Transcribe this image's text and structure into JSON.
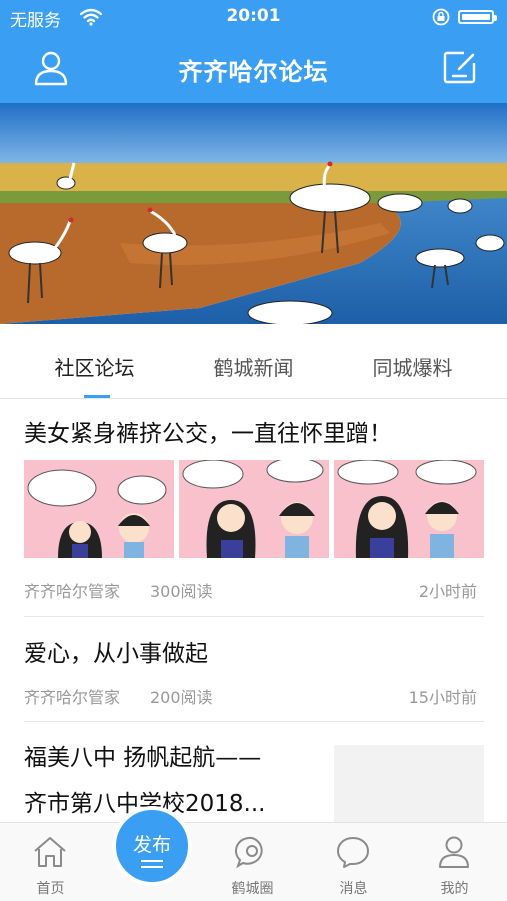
{
  "status_bar": {
    "carrier": "无服务",
    "time": "20:01"
  },
  "header": {
    "title": "齐齐哈尔论坛"
  },
  "tabs": [
    {
      "label": "社区论坛",
      "active": true
    },
    {
      "label": "鹤城新闻",
      "active": false
    },
    {
      "label": "同城爆料",
      "active": false
    }
  ],
  "posts": [
    {
      "title": "美女紧身裤挤公交，一直往怀里蹭！",
      "author": "齐齐哈尔管家",
      "reads": "300阅读",
      "time": "2小时前"
    },
    {
      "title": "爱心，从小事做起",
      "author": "齐齐哈尔管家",
      "reads": "200阅读",
      "time": "15小时前"
    },
    {
      "title_line1": "福美八中 扬帆起航——",
      "title_line2": "齐市第八中学校2018..."
    }
  ],
  "tabbar": {
    "home": "首页",
    "publish": "发布",
    "circle": "鹤城圈",
    "messages": "消息",
    "mine": "我的"
  },
  "colors": {
    "accent": "#3a9ff2"
  },
  "icons": [
    "wifi-icon",
    "lock-rotation-icon",
    "battery-icon",
    "user-icon",
    "edit-icon",
    "home-icon",
    "circle-icon",
    "message-icon",
    "profile-icon"
  ]
}
